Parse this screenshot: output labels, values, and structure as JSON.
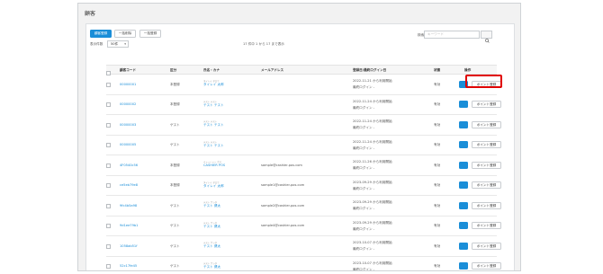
{
  "page": {
    "title": "顧客"
  },
  "toolbar": {
    "csv_download": "顧客登録",
    "bulk_register": "一括削除",
    "bulk_edit": "一括登録",
    "show_label": "表示件数",
    "show_value": "50件",
    "count_text": "17 件中 1 から 17 まで表示",
    "search_label": "検索",
    "search_placeholder": "キーワード"
  },
  "table": {
    "columns": [
      "顧客コード",
      "区分",
      "氏名・カナ",
      "メールアドレス",
      "登録日/最終ログイン日",
      "状態",
      "操作"
    ],
    "point_label": "ポイント登録",
    "rows": [
      {
        "code": "00000001",
        "type": "本登録",
        "kana": "タイレイ タロウ",
        "name": "タイレイ 太郎",
        "email": "",
        "date1": "2022-11-21 から利用開始",
        "date2": "最終ログイン -",
        "status": "有効"
      },
      {
        "code": "00000002",
        "type": "本登録",
        "kana": "テスト テスト",
        "name": "テスト テスト",
        "email": "",
        "date1": "2022-11-24 から利用開始",
        "date2": "最終ログイン -",
        "status": "有効"
      },
      {
        "code": "00000003",
        "type": "ゲスト",
        "kana": "テスト テスト",
        "name": "テスト テスト",
        "email": "",
        "date1": "2022-11-24 から利用開始",
        "date2": "最終ログイン -",
        "status": "有効"
      },
      {
        "code": "00000005",
        "type": "ゲスト",
        "kana": "テスト テスト",
        "name": "テスト テスト",
        "email": "",
        "date1": "2022-11-24 から利用開始",
        "date2": "最終ログイン -",
        "status": "有効"
      },
      {
        "code": "4F0540c56",
        "type": "本登録",
        "kana": "キャッシャー ポス",
        "name": "CASHIER POS",
        "email": "sample@cashier-pos.com",
        "date1": "2022-11-26 から利用開始",
        "date2": "最終ログイン -",
        "status": "有効"
      },
      {
        "code": "ce5eb79e8",
        "type": "本登録",
        "kana": "タイレイ タロウ",
        "name": "タイレイ 太郎",
        "email": "sample1@cashier-pos.com",
        "date1": "2023-09-29 から利用開始",
        "date2": "最終ログイン -",
        "status": "有効"
      },
      {
        "code": "9fc4b5a98",
        "type": "ゲスト",
        "kana": "テスト ケンタ",
        "name": "テスト 健太",
        "email": "sample2@cashier-pos.com",
        "date1": "2023-09-29 から利用開始",
        "date2": "最終ログイン -",
        "status": "有効"
      },
      {
        "code": "9d1ee79b1",
        "type": "ゲスト",
        "kana": "テスト ケンタ",
        "name": "テスト 健太",
        "email": "sample4@cashier-pos.com",
        "date1": "2023-09-29 から利用開始",
        "date2": "最終ログイン -",
        "status": "有効"
      },
      {
        "code": "1058ab51f",
        "type": "ゲスト",
        "kana": "テスト ケンタ",
        "name": "テスト 健太",
        "email": "",
        "date1": "2023-10-07 から利用開始",
        "date2": "最終ログイン -",
        "status": "有効"
      },
      {
        "code": "52c17fe45",
        "type": "ゲスト",
        "kana": "テスト ケンタ",
        "name": "テスト 健太",
        "email": "",
        "date1": "2023-10-07 から利用開始",
        "date2": "最終ログイン -",
        "status": "有効"
      }
    ]
  },
  "colors": {
    "accent": "#1a8ed8",
    "highlight": "#e00000"
  }
}
